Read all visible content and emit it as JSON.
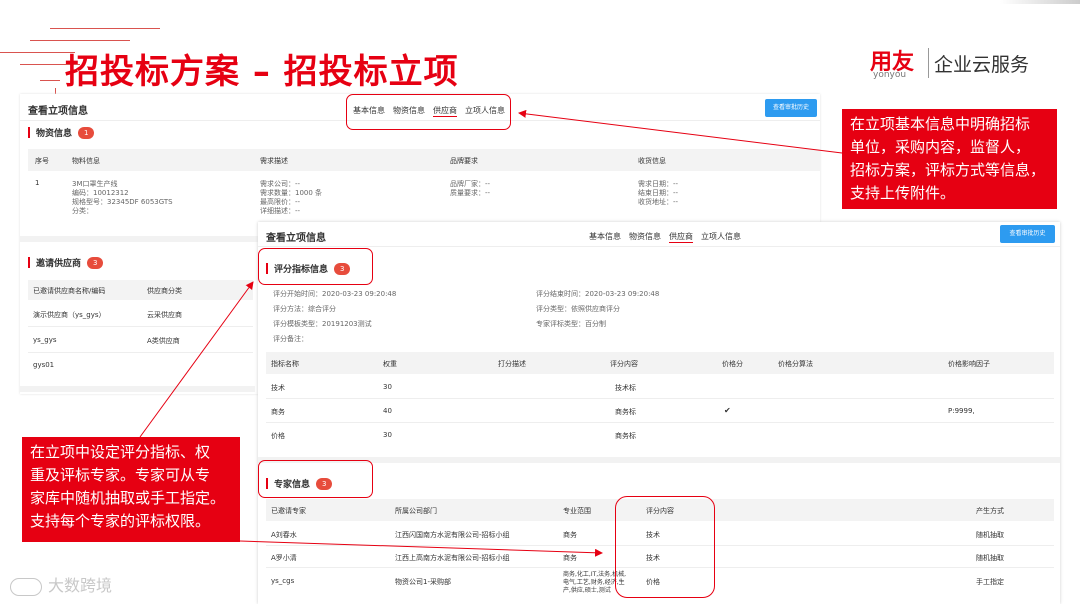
{
  "header": {
    "title": "招投标方案 – 招投标立项",
    "brand_name": "用友",
    "brand_sub": "yonyou",
    "brand_service": "企业云服务"
  },
  "back_panel": {
    "title": "查看立项信息",
    "tabs": [
      "基本信息",
      "物资信息",
      "供应商",
      "立项人信息"
    ],
    "history_button": "查看审批历史",
    "material": {
      "label": "物资信息",
      "count": "1",
      "columns": [
        "序号",
        "物料信息",
        "需求描述",
        "品牌要求",
        "收货信息"
      ],
      "row": {
        "index": "1",
        "material": [
          "3M口罩生产线",
          "编码：10012312",
          "规格型号：32345DF 6053GTS",
          "分类："
        ],
        "demand": [
          "需求公司：--",
          "需求数量：1000 条",
          "最高限价：--",
          "详细描述：--"
        ],
        "brand": [
          "品牌厂家：--",
          "质量要求：--"
        ],
        "receive": [
          "需求日期：--",
          "结束日期：--",
          "收货地址：--"
        ]
      }
    },
    "suppliers": {
      "label": "邀请供应商",
      "count": "3",
      "columns": [
        "已邀请供应商名称/编码",
        "供应商分类"
      ],
      "rows": [
        [
          "演示供应商（ys_gys）",
          "云采供应商"
        ],
        [
          "ys_gys",
          "A类供应商"
        ],
        [
          "gys01",
          ""
        ]
      ]
    }
  },
  "front_panel": {
    "title": "查看立项信息",
    "tabs": [
      "基本信息",
      "物资信息",
      "供应商",
      "立项人信息"
    ],
    "history_button": "查看审批历史",
    "score": {
      "label": "评分指标信息",
      "count": "3",
      "info_left": [
        "评分开始时间：2020-03-23 09:20:48",
        "评分方法：综合评分",
        "评分模板类型：20191203测试",
        "评分备注："
      ],
      "info_right": [
        "评分结束时间：2020-03-23 09:20:48",
        "评分类型：依照供应商评分",
        "专家评标类型：百分制"
      ],
      "columns": [
        "指标名称",
        "权重",
        "打分描述",
        "评分内容",
        "价格分",
        "价格分算法",
        "价格影响因子"
      ],
      "rows": [
        {
          "name": "技术",
          "weight": "30",
          "content": "技术标",
          "price": "",
          "factor": ""
        },
        {
          "name": "商务",
          "weight": "40",
          "content": "商务标",
          "price": "✔",
          "factor": "P:9999,"
        },
        {
          "name": "价格",
          "weight": "30",
          "content": "商务标",
          "price": "",
          "factor": ""
        }
      ]
    },
    "experts": {
      "label": "专家信息",
      "count": "3",
      "columns": [
        "已邀请专家",
        "所属公司部门",
        "专业范围",
        "评分内容",
        "产生方式"
      ],
      "rows": [
        {
          "name": "A刘春水",
          "dept": "江西闪国南方水泥有限公司-招标小组",
          "scope": [
            "商务"
          ],
          "content": "技术",
          "mode": "随机抽取"
        },
        {
          "name": "A罗小清",
          "dept": "江西上高南方水泥有限公司-招标小组",
          "scope": [
            "商务"
          ],
          "content": "技术",
          "mode": "随机抽取"
        },
        {
          "name": "ys_cgs",
          "dept": "物资公司1-采购部",
          "scope": [
            "商务,化工,IT,法务,机械,",
            "电气,工艺,财务,经济,生",
            "产,供应,硕士,测试"
          ],
          "content": "价格",
          "mode": "手工指定"
        }
      ]
    }
  },
  "callouts": {
    "right": [
      "在立项基本信息中明确招标",
      "单位，采购内容，监督人，",
      "招标方案，评标方式等信息，",
      "支持上传附件。"
    ],
    "left": [
      "在立项中设定评分指标、权",
      "重及评标专家。专家可从专",
      "家库中随机抽取或手工指定。",
      "支持每个专家的评标权限。"
    ]
  },
  "watermark": "大数跨境",
  "colors": {
    "accent": "#e60012",
    "button": "#2d9bf0"
  }
}
